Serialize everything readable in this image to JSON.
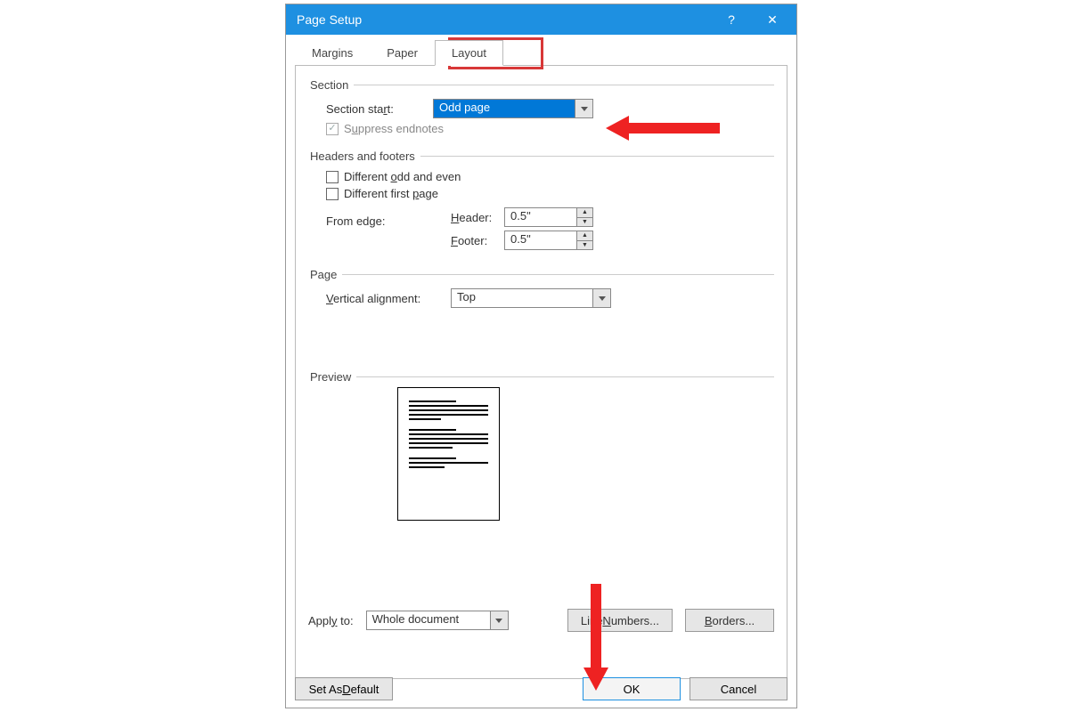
{
  "dialog": {
    "title": "Page Setup"
  },
  "tabs": {
    "margins": "Margins",
    "paper": "Paper",
    "layout": "Layout"
  },
  "section": {
    "group": "Section",
    "start_label_pre": "Section sta",
    "start_label_u": "r",
    "start_label_post": "t:",
    "start_value": "Odd page",
    "suppress_label_pre": "S",
    "suppress_label_u": "u",
    "suppress_label_post": "ppress endnotes"
  },
  "hf": {
    "group": "Headers and footers",
    "diff_oe_pre": "Different ",
    "diff_oe_u": "o",
    "diff_oe_post": "dd and even",
    "diff_fp_pre": "Different first ",
    "diff_fp_u": "p",
    "diff_fp_post": "age",
    "from_edge": "From edge:",
    "header_u": "H",
    "header_post": "eader:",
    "header_val": "0.5\"",
    "footer_u": "F",
    "footer_post": "ooter:",
    "footer_val": "0.5\""
  },
  "page": {
    "group": "Page",
    "valign_u": "V",
    "valign_post": "ertical alignment:",
    "valign_val": "Top"
  },
  "preview": {
    "group": "Preview"
  },
  "apply": {
    "label_pre": "Appl",
    "label_u": "y",
    "label_post": " to:",
    "value": "Whole document",
    "line_numbers_pre": "Line ",
    "line_numbers_u": "N",
    "line_numbers_post": "umbers...",
    "borders_u": "B",
    "borders_post": "orders..."
  },
  "actions": {
    "default_u": "D",
    "default_pre": "Set As ",
    "default_post": "efault",
    "ok": "OK",
    "cancel": "Cancel"
  }
}
